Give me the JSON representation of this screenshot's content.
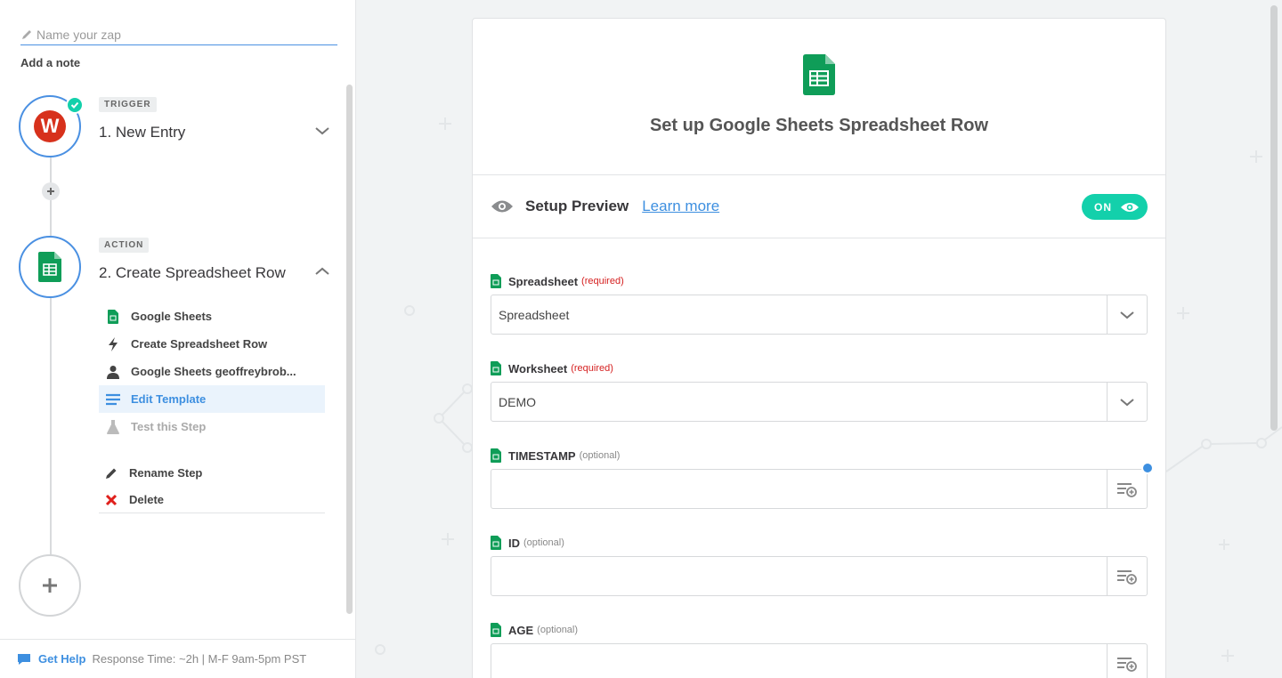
{
  "sidebar": {
    "zap_name_placeholder": "Name your zap",
    "add_note": "Add a note",
    "trigger": {
      "tag": "TRIGGER",
      "title": "1. New Entry",
      "app_icon": "wufoo-logo",
      "app_letter": "W"
    },
    "action": {
      "tag": "ACTION",
      "title": "2. Create Spreadsheet Row",
      "substeps": [
        {
          "label": "Google Sheets",
          "icon": "sheets-icon"
        },
        {
          "label": "Create Spreadsheet Row",
          "icon": "bolt-icon"
        },
        {
          "label": "Google Sheets geoffreybrob...",
          "icon": "user-icon"
        },
        {
          "label": "Edit Template",
          "icon": "list-icon",
          "active": true
        },
        {
          "label": "Test this Step",
          "icon": "flask-icon",
          "disabled": true
        }
      ],
      "rename_label": "Rename Step",
      "delete_label": "Delete"
    },
    "help": {
      "link": "Get Help",
      "text": "Response Time: ~2h | M-F 9am-5pm PST"
    }
  },
  "main": {
    "title": "Set up Google Sheets Spreadsheet Row",
    "preview": {
      "title": "Setup Preview",
      "learn_more": "Learn more",
      "toggle_label": "ON"
    },
    "fields": [
      {
        "label": "Spreadsheet",
        "qualifier": "(required)",
        "required": true,
        "value": "Spreadsheet",
        "control": "dropdown"
      },
      {
        "label": "Worksheet",
        "qualifier": "(required)",
        "required": true,
        "value": "DEMO",
        "control": "dropdown"
      },
      {
        "label": "TIMESTAMP",
        "qualifier": "(optional)",
        "required": false,
        "value": "",
        "control": "insert-field"
      },
      {
        "label": "ID",
        "qualifier": "(optional)",
        "required": false,
        "value": "",
        "control": "insert-field"
      },
      {
        "label": "AGE",
        "qualifier": "(optional)",
        "required": false,
        "value": "",
        "control": "insert-field"
      }
    ]
  },
  "colors": {
    "accent": "#4a90e2",
    "toggle_on": "#13d0ab",
    "sheets_green": "#0f9d58",
    "required_red": "#d52020",
    "wufoo_red": "#d7311c"
  }
}
